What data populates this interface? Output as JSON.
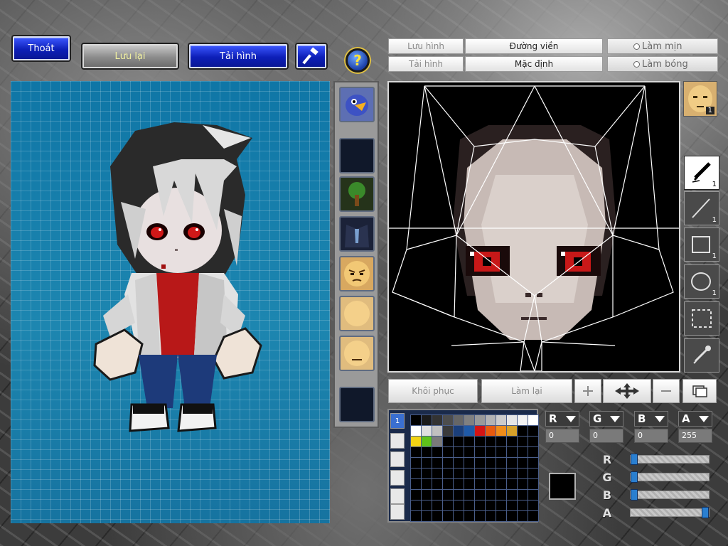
{
  "top_buttons": {
    "exit": "Thoát",
    "save": "Lưu lại",
    "reload": "Tải hình",
    "help": "?"
  },
  "editor_header": {
    "save_image": "Lưu hình",
    "load_image": "Tải hình",
    "outline": "Đường viền",
    "default": "Mặc định",
    "smooth": "Làm mịn",
    "shade": "Làm bóng"
  },
  "tools": {
    "pencil_count": "1",
    "line_count": "1",
    "rect_count": "1",
    "ellipse_count": "1",
    "face_badge": "1"
  },
  "actions": {
    "restore": "Khôi phục",
    "redo": "Làm lại"
  },
  "palette": {
    "tab_label": "1",
    "colors": [
      "#000000",
      "#1a1a1a",
      "#333333",
      "#4d4d4d",
      "#666666",
      "#808080",
      "#999999",
      "#b3b3b3",
      "#cccccc",
      "#e6e6e6",
      "#f2f2f2",
      "#ffffff",
      "#ffffff",
      "#e0e0e0",
      "#c0c0c0",
      "#3a3a3a",
      "#1b3f7a",
      "#1f5aa8",
      "#d41414",
      "#e85a0f",
      "#f08d1a",
      "#d7a12a",
      "#000000",
      "#000000",
      "#f2d313",
      "#5fc21a",
      "#7a7a7a",
      "#000000",
      "#000000",
      "#000000",
      "#000000",
      "#000000",
      "#000000",
      "#000000",
      "#000000",
      "#000000"
    ]
  },
  "channels": {
    "r_label": "R",
    "g_label": "G",
    "b_label": "B",
    "a_label": "A",
    "r_value": "0",
    "g_value": "0",
    "b_value": "0",
    "a_value": "255",
    "current_color": "#000000"
  },
  "sliders": {
    "r": 0,
    "g": 0,
    "b": 0,
    "a": 255
  }
}
